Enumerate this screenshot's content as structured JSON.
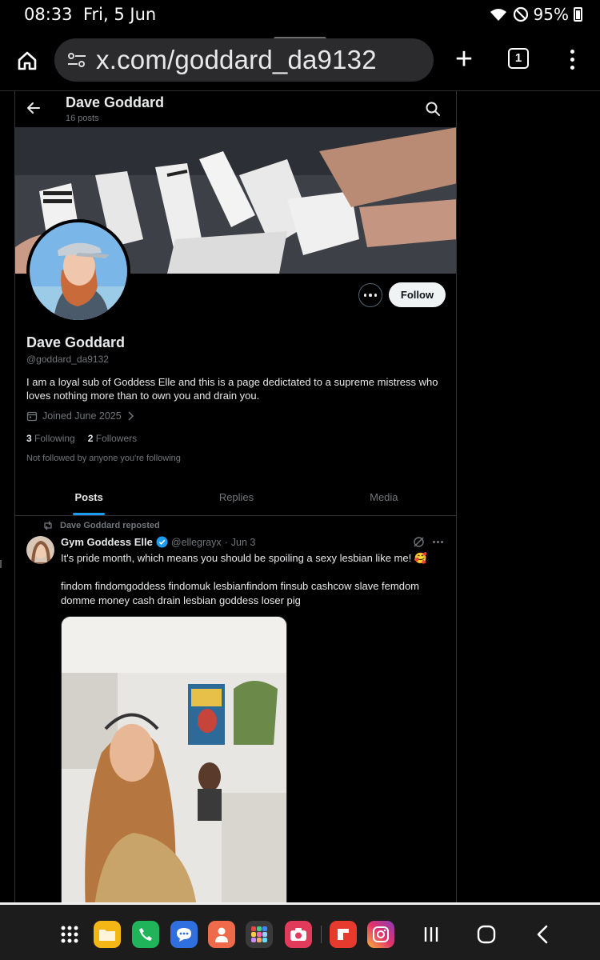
{
  "status_bar": {
    "time": "08:33",
    "date": "Fri, 5 Jun",
    "battery": "95%"
  },
  "browser": {
    "url": "x.com/goddard_da9132",
    "tab_count": "1"
  },
  "profile": {
    "header_name": "Dave Goddard",
    "post_count": "16 posts",
    "display_name": "Dave Goddard",
    "handle": "@goddard_da9132",
    "bio": "I am a loyal sub of Goddess Elle and this is a page dedictated to a supreme mistress who loves nothing more than to own you and drain you.",
    "joined": "Joined June 2025",
    "following_count": "3",
    "following_label": "Following",
    "followers_count": "2",
    "followers_label": "Followers",
    "not_followed": "Not followed by anyone you're following",
    "follow_label": "Follow"
  },
  "tabs": [
    {
      "label": "Posts",
      "active": true
    },
    {
      "label": "Replies",
      "active": false
    },
    {
      "label": "Media",
      "active": false
    }
  ],
  "post": {
    "repost_label": "Dave Goddard reposted",
    "author": "Gym Goddess Elle",
    "handle": "@ellegrayx",
    "separator": "·",
    "date": "Jun 3",
    "text": "It's pride month, which means you should be spoiling a sexy lesbian like me! 🥰",
    "tags": "findom findomgoddess findomuk lesbianfindom finsub cashcow slave femdom domme money cash drain lesbian goddess loser pig"
  },
  "colors": {
    "accent": "#1d9bf0",
    "background": "#000000",
    "text_primary": "#e7e9ea",
    "text_secondary": "#71767b",
    "border": "#2f3336"
  },
  "dock_icons": [
    "apps-grid-icon",
    "files-icon",
    "phone-icon",
    "messages-icon",
    "contacts-icon",
    "app-folder-icon",
    "camera-icon",
    "flipboard-icon",
    "instagram-icon"
  ],
  "nav_buttons": [
    "recents-icon",
    "home-icon",
    "back-icon"
  ]
}
